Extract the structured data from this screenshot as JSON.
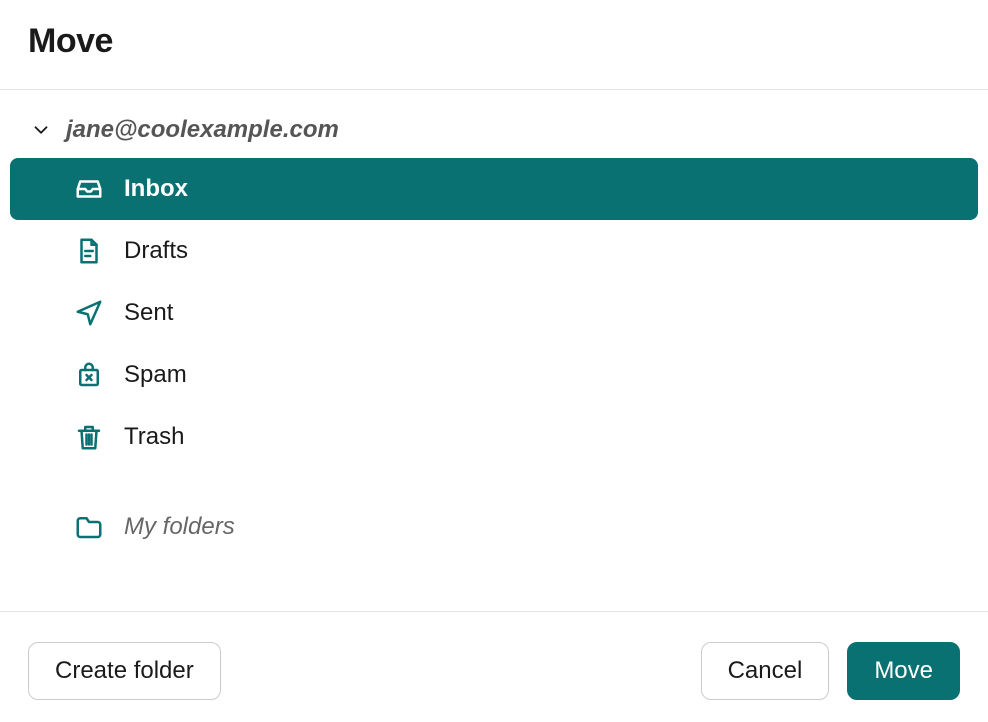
{
  "dialog": {
    "title": "Move"
  },
  "account": {
    "email": "jane@coolexample.com"
  },
  "folders": [
    {
      "id": "inbox",
      "label": "Inbox",
      "icon": "inbox-icon",
      "selected": true
    },
    {
      "id": "drafts",
      "label": "Drafts",
      "icon": "drafts-icon",
      "selected": false
    },
    {
      "id": "sent",
      "label": "Sent",
      "icon": "sent-icon",
      "selected": false
    },
    {
      "id": "spam",
      "label": "Spam",
      "icon": "spam-icon",
      "selected": false
    },
    {
      "id": "trash",
      "label": "Trash",
      "icon": "trash-icon",
      "selected": false
    }
  ],
  "custom_folders": {
    "label": "My folders"
  },
  "buttons": {
    "create_folder": "Create folder",
    "cancel": "Cancel",
    "move": "Move"
  },
  "colors": {
    "accent": "#0a7173"
  }
}
